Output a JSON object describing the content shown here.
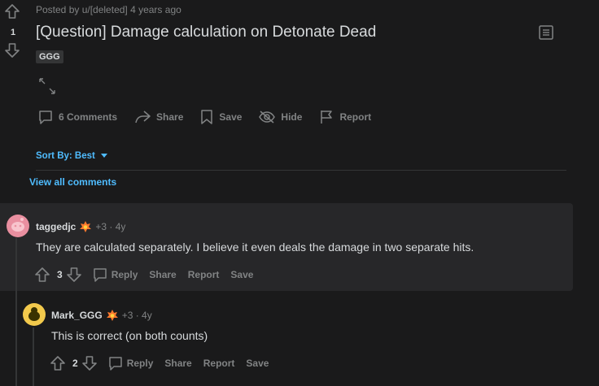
{
  "post": {
    "score": "1",
    "meta": "Posted by u/[deleted] 4 years ago",
    "title": "[Question] Damage calculation on Detonate Dead",
    "flair": "GGG",
    "actions": {
      "comments": "6 Comments",
      "share": "Share",
      "save": "Save",
      "hide": "Hide",
      "report": "Report"
    }
  },
  "comments_section": {
    "sort_label": "Sort By: Best",
    "view_all": "View all comments"
  },
  "comments": [
    {
      "author": "taggedjc",
      "meta": "+3 · 4y",
      "body": "They are calculated separately. I believe it even deals the damage in two separate hits.",
      "score": "3",
      "actions": {
        "reply": "Reply",
        "share": "Share",
        "report": "Report",
        "save": "Save"
      },
      "avatar_color": "#e98fa0"
    },
    {
      "author": "Mark_GGG",
      "meta": "+3 · 4y",
      "body": "This is correct (on both counts)",
      "score": "2",
      "actions": {
        "reply": "Reply",
        "share": "Share",
        "report": "Report",
        "save": "Save"
      },
      "avatar_color": "#f2c94c"
    }
  ],
  "colors": {
    "background": "#1a1a1b",
    "highlight_comment": "#272729",
    "link": "#4fbcff",
    "muted": "#818384",
    "text": "#d7dadc"
  },
  "icons": [
    "upvote-icon",
    "downvote-icon",
    "comment-icon",
    "share-icon",
    "save-icon",
    "hide-icon",
    "report-icon",
    "expand-icon",
    "text-post-icon",
    "chevron-down-icon",
    "award-icon"
  ]
}
